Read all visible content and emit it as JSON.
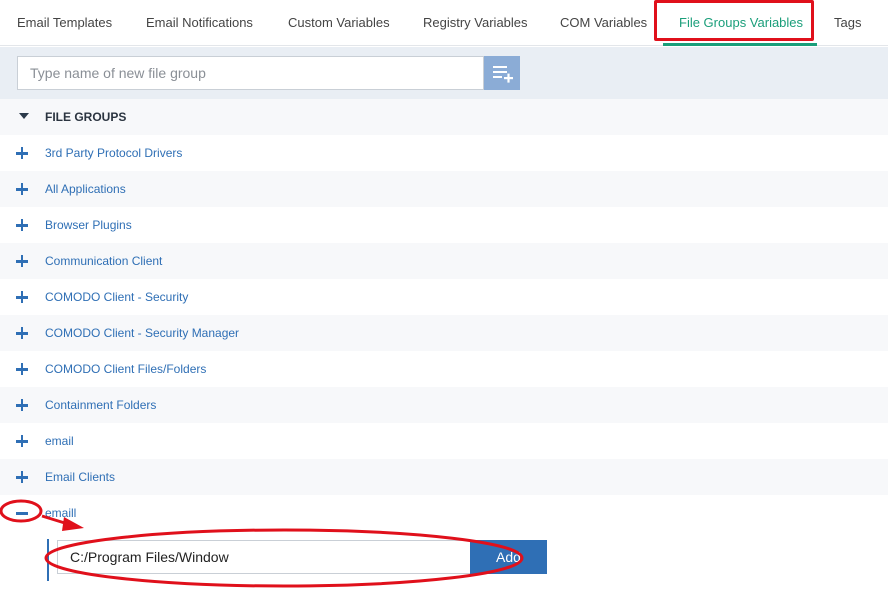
{
  "tabs": [
    {
      "label": "Email Templates",
      "active": false
    },
    {
      "label": "Email Notifications",
      "active": false
    },
    {
      "label": "Custom Variables",
      "active": false
    },
    {
      "label": "Registry Variables",
      "active": false
    },
    {
      "label": "COM Variables",
      "active": false
    },
    {
      "label": "File Groups Variables",
      "active": true
    },
    {
      "label": "Tags",
      "active": false
    }
  ],
  "new_group": {
    "placeholder": "Type name of new file group",
    "add_icon": "list-add-icon"
  },
  "tree": {
    "header": "FILE GROUPS",
    "items": [
      {
        "label": "3rd Party Protocol Drivers",
        "expanded": false
      },
      {
        "label": "All Applications",
        "expanded": false
      },
      {
        "label": "Browser Plugins",
        "expanded": false
      },
      {
        "label": "Communication Client",
        "expanded": false
      },
      {
        "label": "COMODO Client - Security",
        "expanded": false
      },
      {
        "label": "COMODO Client - Security Manager",
        "expanded": false
      },
      {
        "label": "COMODO Client Files/Folders",
        "expanded": false
      },
      {
        "label": "Containment Folders",
        "expanded": false
      },
      {
        "label": "email",
        "expanded": false
      },
      {
        "label": "Email Clients",
        "expanded": false
      },
      {
        "label": "emaill",
        "expanded": true
      }
    ]
  },
  "expanded_group": {
    "path_value": "C:/Program Files/Window",
    "add_label": "Add"
  },
  "colors": {
    "accent": "#1a9e7a",
    "link": "#2f6fb5",
    "annotation": "#e0101b"
  }
}
